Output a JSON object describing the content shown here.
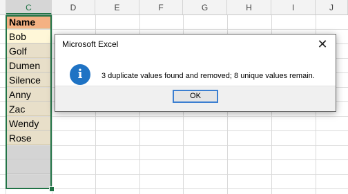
{
  "columns": [
    "C",
    "D",
    "E",
    "F",
    "G",
    "H",
    "I",
    "J"
  ],
  "cells": {
    "header": "Name",
    "values": [
      "Bob",
      "Golf",
      "Dumen",
      "Silence",
      "Anny",
      "Zac",
      "Wendy",
      "Rose"
    ]
  },
  "dialog": {
    "title": "Microsoft Excel",
    "close_glyph": "✕",
    "icon": "info-icon",
    "icon_glyph": "i",
    "message": "3 duplicate values found and removed; 8 unique values remain.",
    "ok_label": "OK"
  },
  "colors": {
    "header_fill": "#f4b183",
    "data_fill": "#e8dfc9",
    "selection_border": "#217346",
    "info_icon": "#1f73c4"
  }
}
